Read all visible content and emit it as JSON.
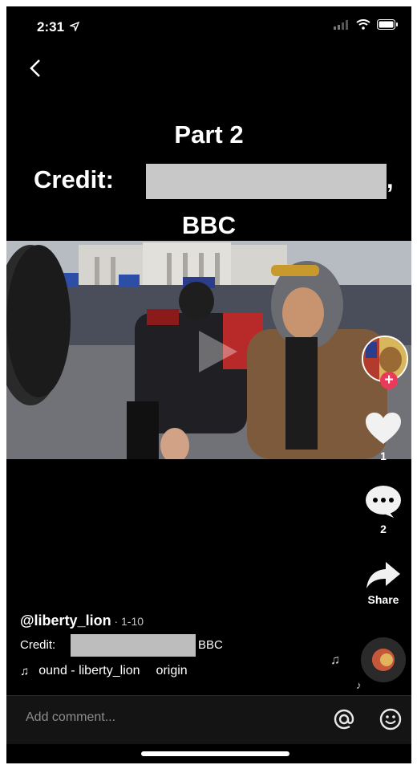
{
  "status_bar": {
    "time": "2:31"
  },
  "overlay": {
    "line1": "Part 2",
    "line2_prefix": "Credit:",
    "line2_suffix": ",",
    "line3": "BBC"
  },
  "actions": {
    "likes": "1",
    "comments": "2",
    "share_label": "Share"
  },
  "caption": {
    "username": "@liberty_lion",
    "date": " · 1-10",
    "credit_label": "Credit:",
    "credit_end": "BBC",
    "sound": "ound - liberty_lion",
    "sound_suffix": "origin"
  },
  "comment_bar": {
    "placeholder": "Add comment..."
  },
  "icons": [
    "back-icon",
    "play-icon",
    "heart-icon",
    "comment-icon",
    "share-icon",
    "music-note-icon",
    "at-icon",
    "emoji-icon"
  ]
}
